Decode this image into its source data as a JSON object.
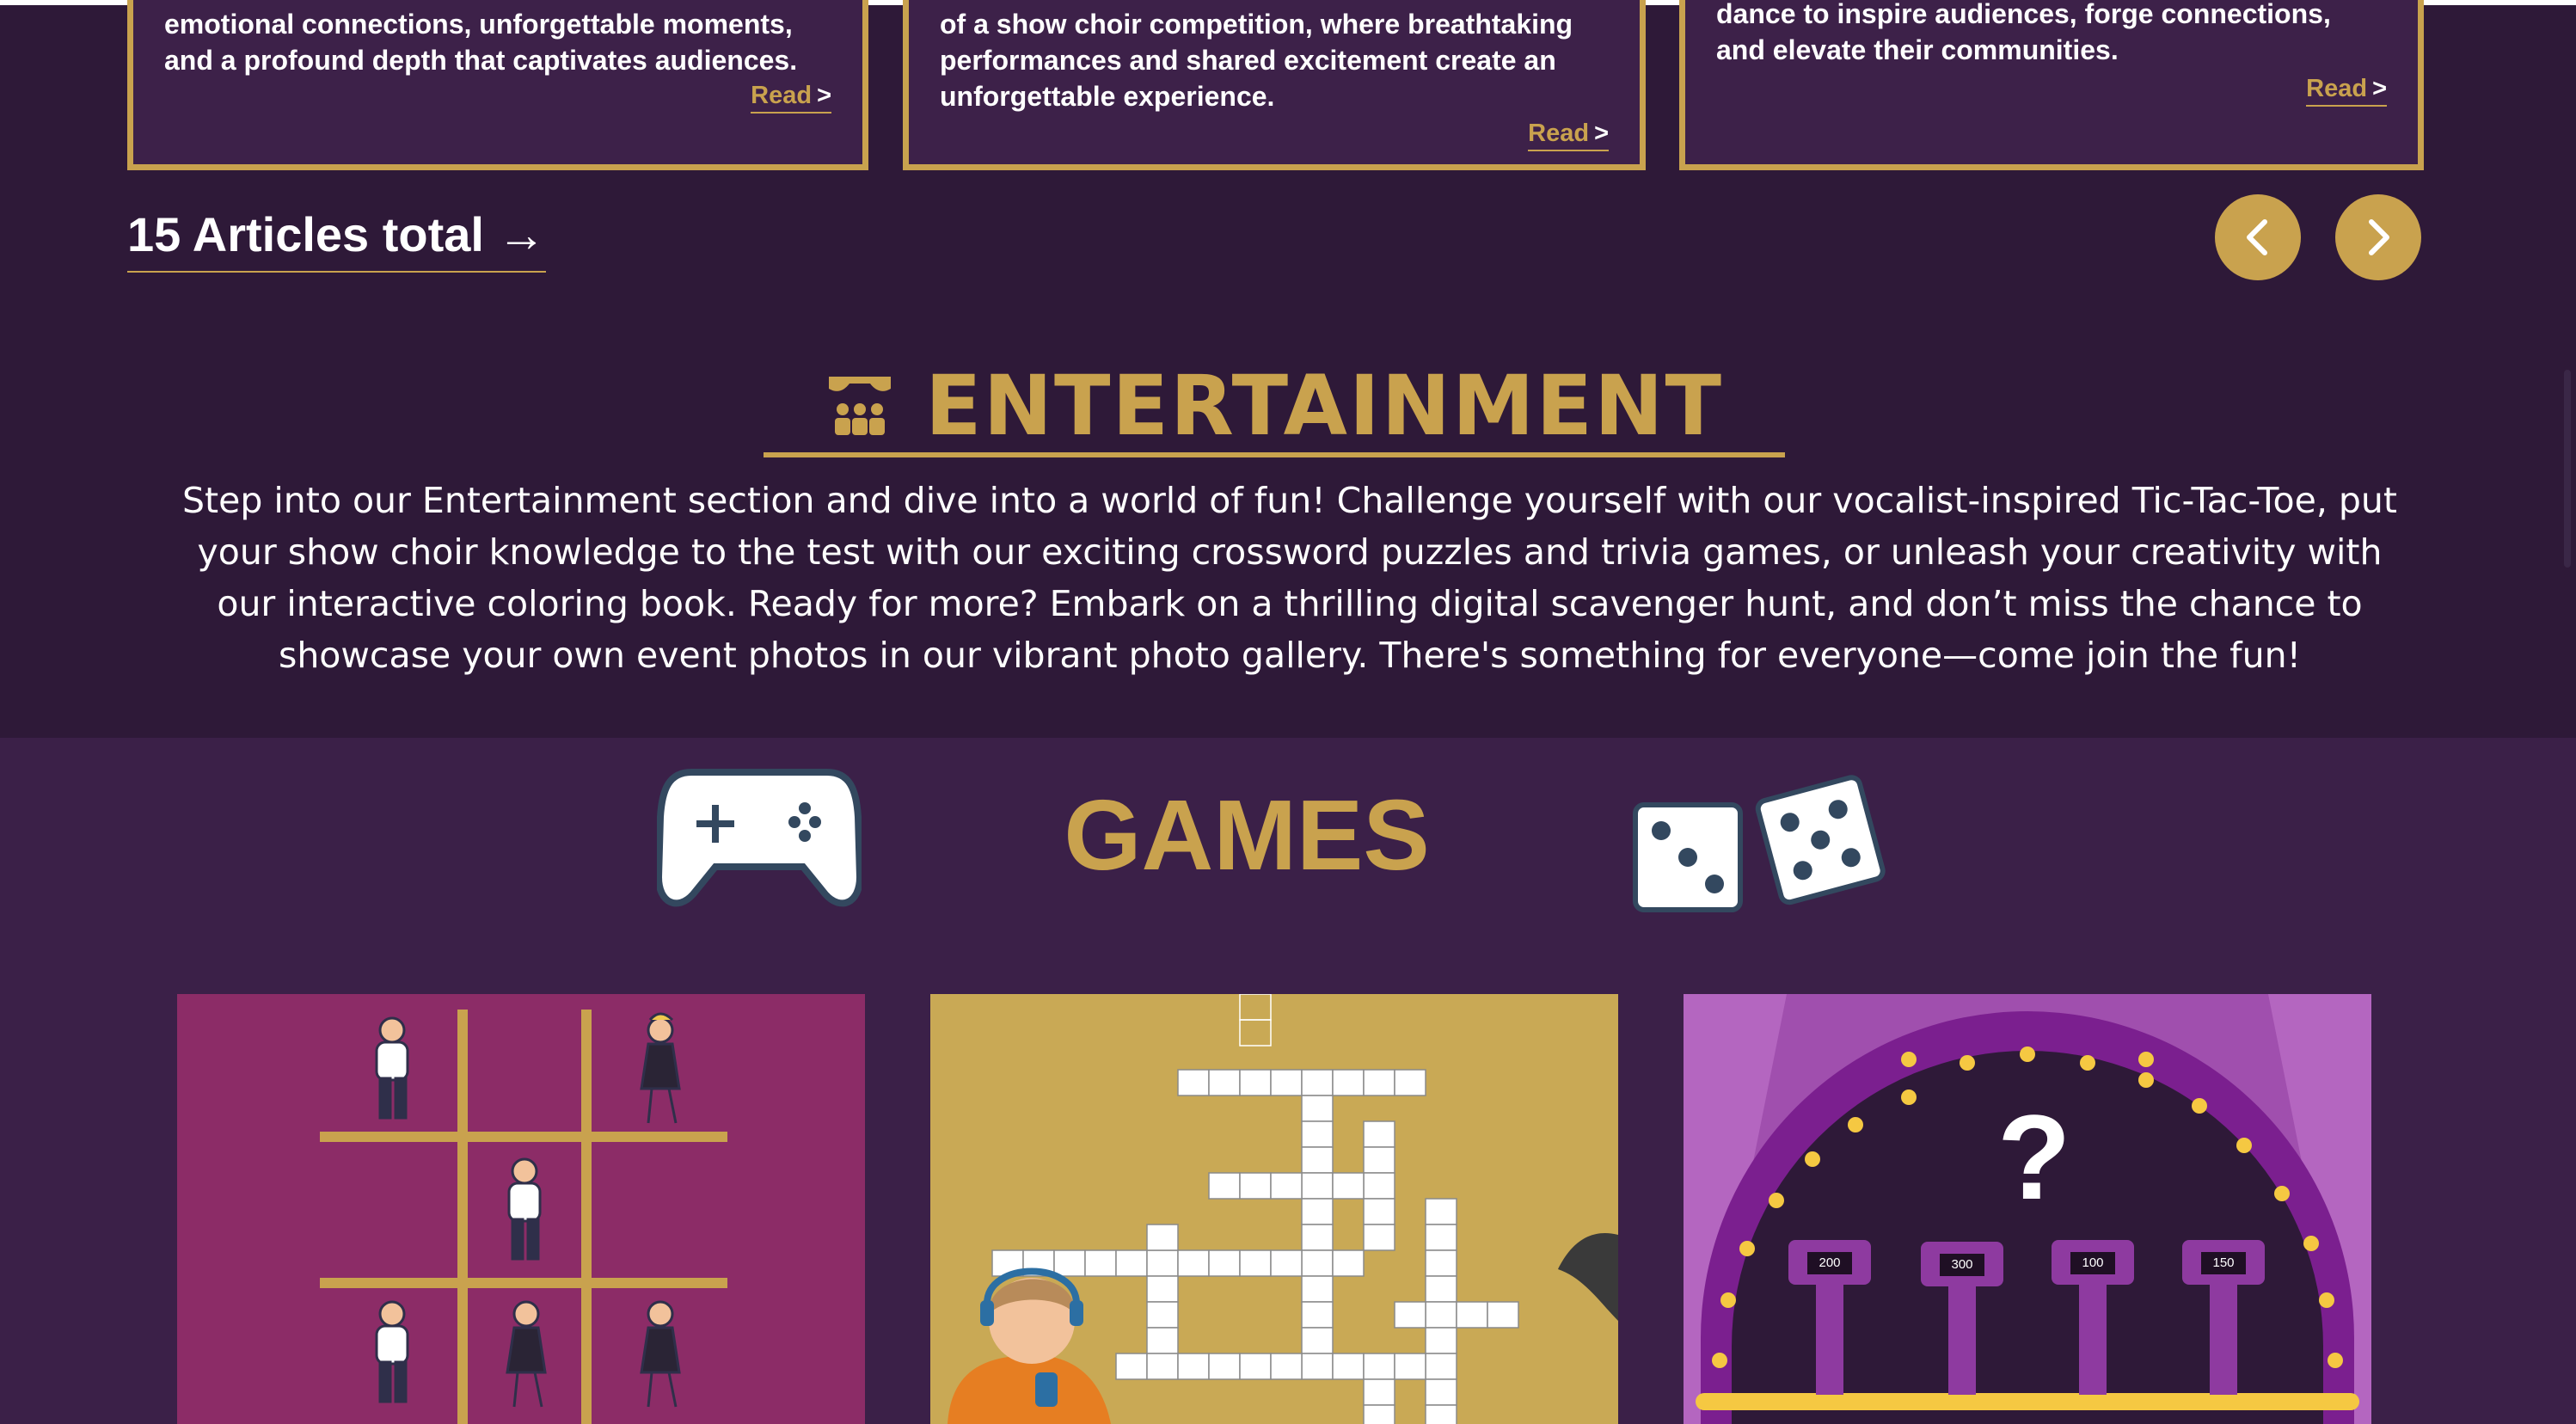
{
  "articles": {
    "cards": [
      {
        "text": "emotional connections, unforgettable moments, and a profound depth that captivates audiences.",
        "read_label": "Read",
        "read_arrow": ">"
      },
      {
        "text": "of a show choir competition, where breathtaking performances and shared excitement create an unforgettable experience.",
        "read_label": "Read",
        "read_arrow": ">"
      },
      {
        "text": "dance to inspire audiences, forge connections, and elevate their communities.",
        "read_label": "Read",
        "read_arrow": ">"
      }
    ],
    "total_label": "15 Articles total →",
    "prev_icon": "chevron-left-icon",
    "next_icon": "chevron-right-icon"
  },
  "entertainment": {
    "icon": "theater-stage-icon",
    "title": "ENTERTAINMENT",
    "description": "Step into our Entertainment section and dive into a world of fun! Challenge yourself with our vocalist-inspired Tic-Tac-Toe, put your show choir knowledge to the test with our exciting crossword puzzles and trivia games, or unleash your creativity with our interactive coloring book. Ready for more? Embark on a thrilling digital scavenger hunt, and don’t miss the chance to showcase your own event photos in our vibrant photo gallery. There's something for everyone—come join the fun!"
  },
  "games": {
    "title": "GAMES",
    "left_icon": "gamepad-icon",
    "right_icon": "dice-icon",
    "cards": [
      {
        "name": "tic-tac-toe"
      },
      {
        "name": "crossword"
      },
      {
        "name": "trivia",
        "question_mark": "?",
        "podium_values": [
          "200",
          "300",
          "100",
          "150"
        ]
      }
    ]
  },
  "colors": {
    "background": "#2e1938",
    "accent": "#c9a24e",
    "games_bg": "#3b2048"
  }
}
